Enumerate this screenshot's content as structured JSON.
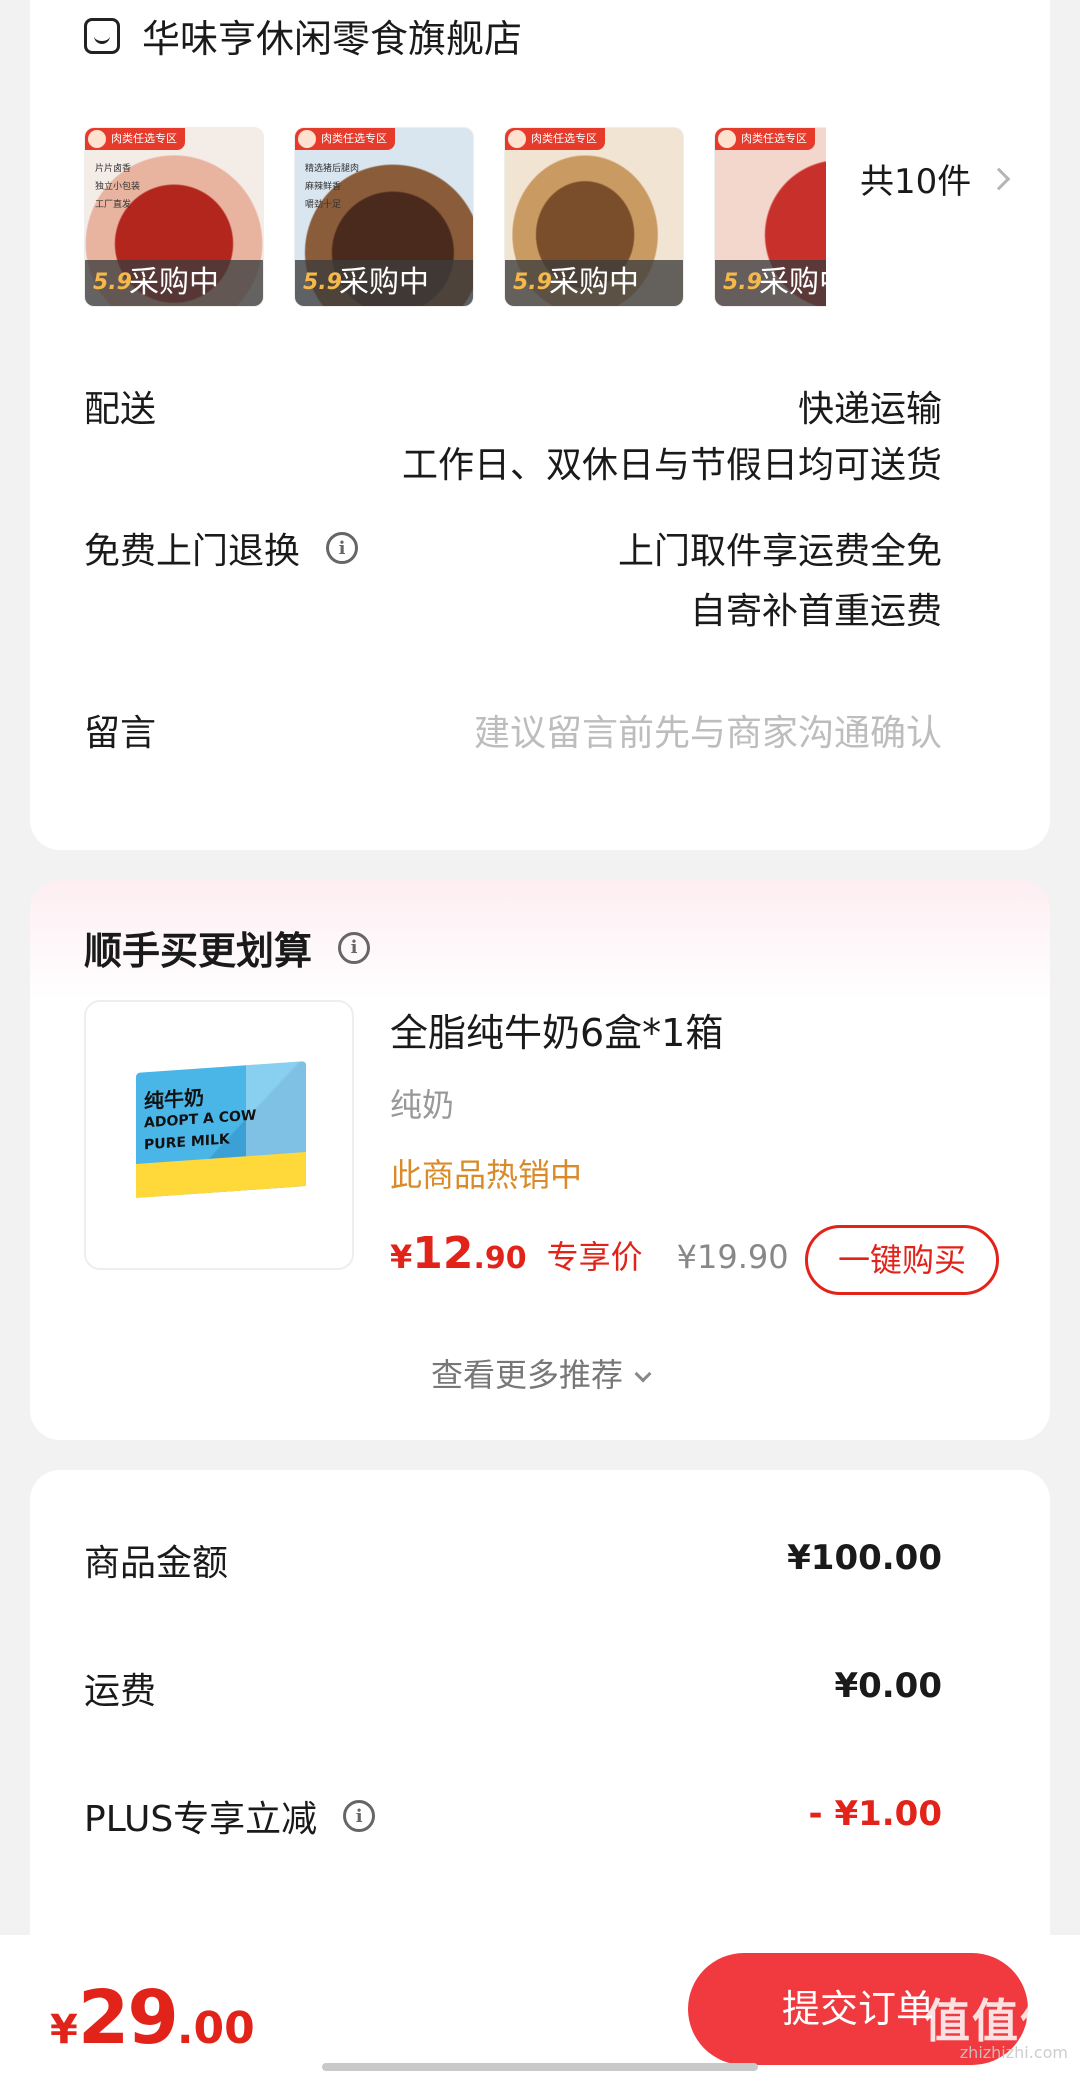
{
  "store": {
    "name": "华味亨休闲零食旗舰店",
    "thumbnails": [
      {
        "tag": "肉类任选专区",
        "status": "采购中",
        "price_prefix": "5.9",
        "lines": [
          "片片卤香",
          "独立小包装",
          "工厂直发"
        ]
      },
      {
        "tag": "肉类任选专区",
        "status": "采购中",
        "price_prefix": "5.9",
        "lines": [
          "精选猪后腿肉",
          "麻辣鲜香",
          "嚼劲十足"
        ]
      },
      {
        "tag": "肉类任选专区",
        "status": "采购中",
        "price_prefix": "5.9",
        "lines": []
      },
      {
        "tag": "肉类任选专区",
        "status": "采购中",
        "price_prefix": "5.9",
        "lines": []
      }
    ],
    "count_label": "共10件"
  },
  "delivery": {
    "label": "配送",
    "value_line1": "快递运输",
    "value_line2": "工作日、双休日与节假日均可送货"
  },
  "return_service": {
    "label": "免费上门退换",
    "value_line1": "上门取件享运费全免",
    "value_line2": "自寄补首重运费"
  },
  "message": {
    "label": "留言",
    "placeholder": "建议留言前先与商家沟通确认"
  },
  "addon": {
    "title": "顺手买更划算",
    "product_name": "全脂纯牛奶6盒*1箱",
    "spec": "纯奶",
    "hot_label": "此商品热销中",
    "price_yen": "¥",
    "price_int": "12",
    "price_dec": ".90",
    "price_tag": "专享价",
    "original_price": "¥19.90",
    "buy_button": "一键购买",
    "more_label": "查看更多推荐",
    "box_label_cn": "纯牛奶",
    "box_label_en1": "ADOPT A COW",
    "box_label_en2": "PURE MILK"
  },
  "summary": {
    "goods_label": "商品金额",
    "goods_value": "¥100.00",
    "shipping_label": "运费",
    "shipping_value": "¥0.00",
    "plus_label": "PLUS专享立减",
    "plus_value": "- ¥1.00"
  },
  "bottom": {
    "total_yen": "¥",
    "total_int": "29",
    "total_dec": ".00",
    "submit_label": "提交订单",
    "watermark": "值值值",
    "watermark_sub": "zhizhizhi.com"
  },
  "colors": {
    "accent_red": "#e2231a",
    "submit_red": "#f03a3f",
    "hot_orange": "#d98b2a"
  }
}
